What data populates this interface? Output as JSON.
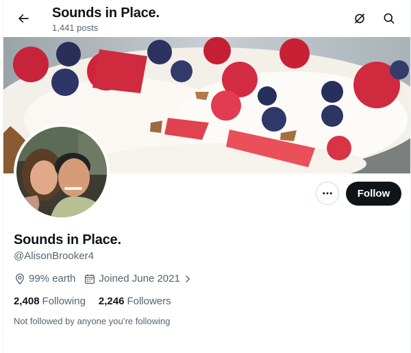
{
  "header": {
    "back_icon": "arrow-left-icon",
    "title": "Sounds in Place.",
    "post_count": "1,441 posts",
    "grok_icon": "grok-icon",
    "search_icon": "search-icon"
  },
  "banner": {
    "image": "berries-cake-photo"
  },
  "avatar": {
    "image": "two-people-selfie-photo"
  },
  "actions": {
    "more_icon": "more-icon",
    "follow_label": "Follow"
  },
  "profile": {
    "name": "Sounds in Place.",
    "handle": "@AlisonBrooker4",
    "location": "99% earth",
    "joined": "Joined June 2021",
    "following_count": "2,408",
    "following_label": "Following",
    "followers_count": "2,246",
    "followers_label": "Followers",
    "not_followed_text": "Not followed by anyone you’re following"
  },
  "colors": {
    "text": "#0f1419",
    "secondary": "#536471",
    "follow_bg": "#0f1419",
    "border": "#cfd9de"
  }
}
